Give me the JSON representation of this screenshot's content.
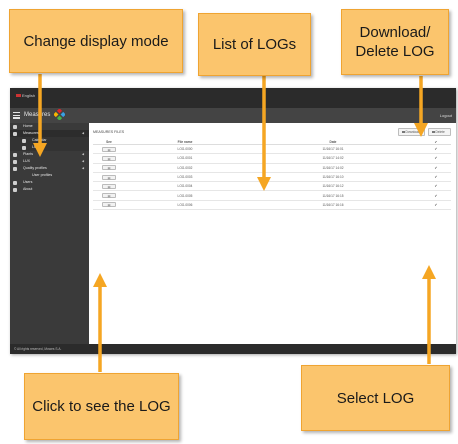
{
  "colors": {
    "callout": "#fbc56d",
    "arrow": "#f5a623",
    "header": "#444444",
    "sidebar": "#3a3a3a"
  },
  "topbar": {
    "language": "English"
  },
  "header": {
    "title": "Measures",
    "brand": "Mowes",
    "logout": "Logout",
    "menu_icon": "hamburger-icon",
    "logo_icon": "colored-squares-logo"
  },
  "sidebar": {
    "items": [
      {
        "label": "Home",
        "icon": "home-icon"
      },
      {
        "label": "Measures",
        "icon": "measures-icon",
        "active": true
      },
      {
        "label": "Calendar",
        "icon": "calendar-icon"
      },
      {
        "label": "List",
        "icon": "list-icon"
      },
      {
        "label": "Plants",
        "icon": "plant-icon"
      },
      {
        "label": "LUX",
        "icon": "lux-icon"
      },
      {
        "label": "Quality profiles",
        "icon": "quality-icon"
      },
      {
        "label": "User profiles",
        "icon": ""
      },
      {
        "label": "Users",
        "icon": "users-icon"
      },
      {
        "label": "About",
        "icon": "info-icon"
      }
    ]
  },
  "content": {
    "title": "MEASURES FILES",
    "download_label": "Download",
    "delete_label": "Delete",
    "columns": [
      "See",
      "File name",
      "Date",
      "✔"
    ],
    "rows": [
      {
        "file": "LOG-0000",
        "date": "11/16/17 16:01"
      },
      {
        "file": "LOG-0001",
        "date": "11/16/17 14:02"
      },
      {
        "file": "LOG-0002",
        "date": "11/16/17 14:02"
      },
      {
        "file": "LOG-0003",
        "date": "11/16/17 16:10"
      },
      {
        "file": "LOG-0004",
        "date": "11/16/17 16:12"
      },
      {
        "file": "LOG-0005",
        "date": "11/16/17 16:15"
      },
      {
        "file": "LOG-0006",
        "date": "11/16/17 16:16"
      }
    ]
  },
  "footer": {
    "text": "© All rights reserved, Mowes S.A."
  },
  "callouts": {
    "change_display_mode": "Change display mode",
    "list_of_logs": "List of LOGs",
    "download_delete": "Download/ Delete LOG",
    "click_to_see": "Click to see the LOG",
    "select_log": "Select LOG"
  }
}
